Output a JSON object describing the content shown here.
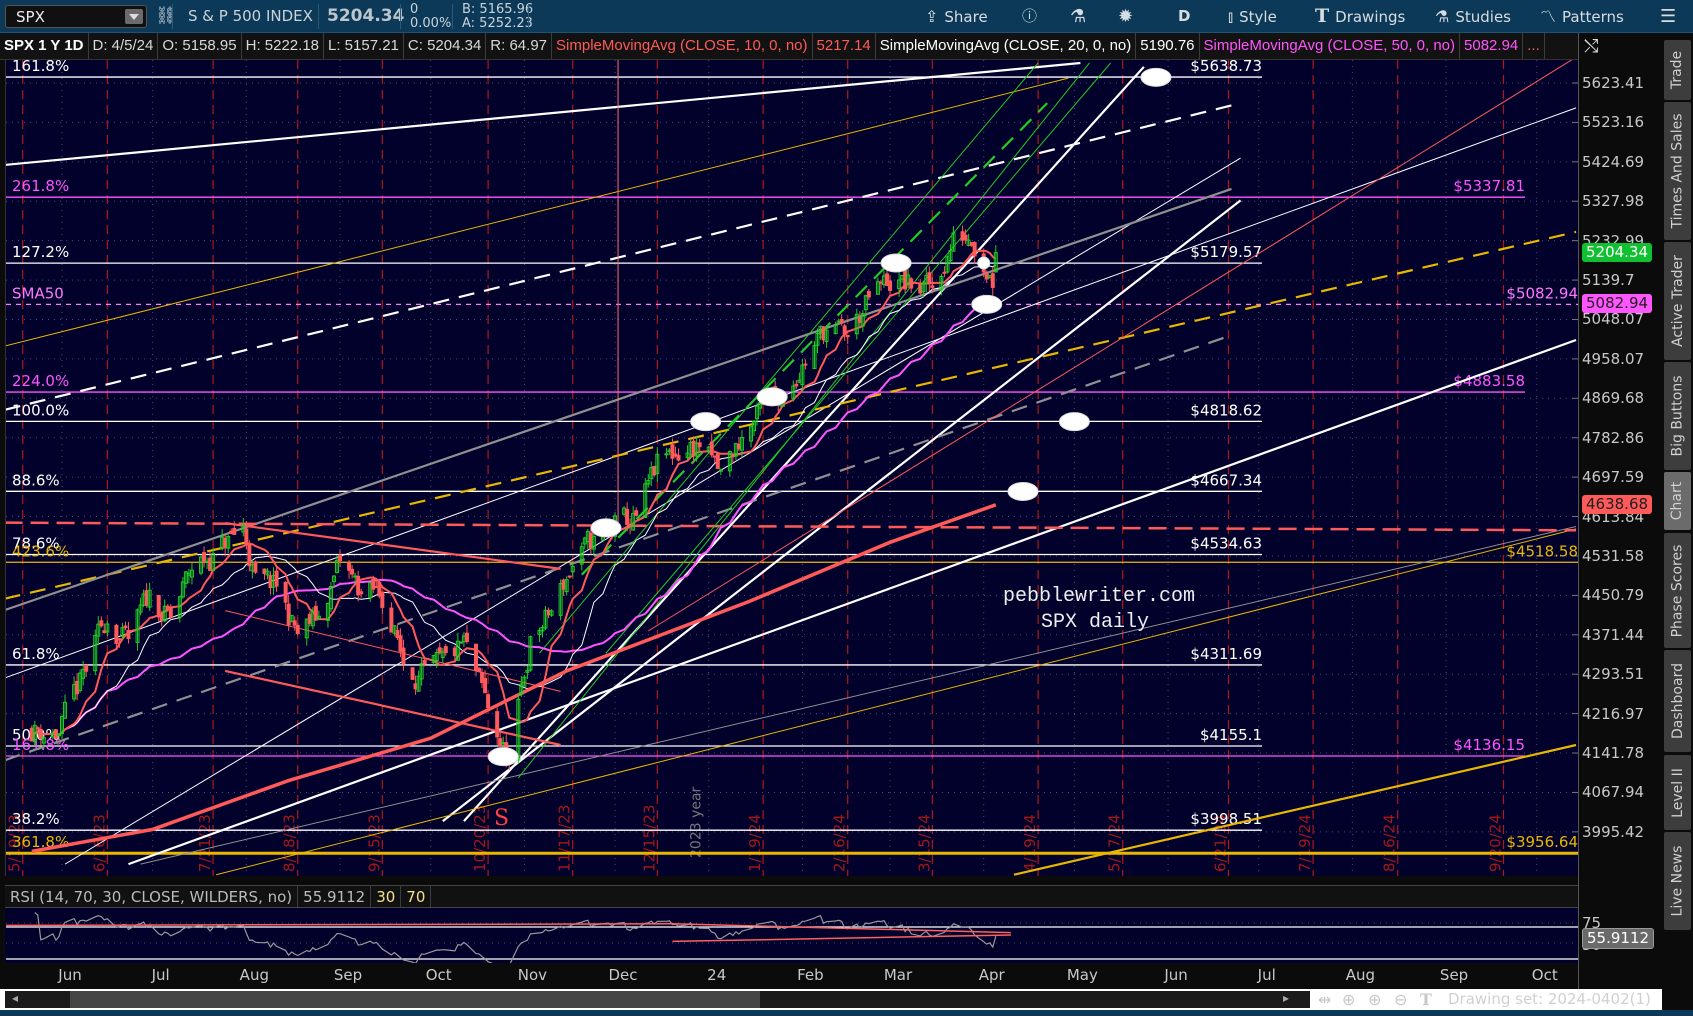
{
  "toolbar": {
    "symbol": "SPX",
    "description": "S & P 500 INDEX",
    "last": "5204.34",
    "change": "0",
    "change_pct": "0.00%",
    "bid": "B: 5165.96",
    "ask": "A: 5252.23",
    "share": "Share",
    "aggregation": "D",
    "style": "Style",
    "drawings": "Drawings",
    "studies": "Studies",
    "patterns": "Patterns"
  },
  "header": {
    "title": "SPX 1 Y 1D",
    "date": "D: 4/5/24",
    "open": "O: 5158.95",
    "high": "H: 5222.18",
    "low": "L: 5157.21",
    "close": "C: 5204.34",
    "range": "R: 64.97",
    "sma10_label": "SimpleMovingAvg (CLOSE, 10, 0, no)",
    "sma10_value": "5217.14",
    "sma20_label": "SimpleMovingAvg (CLOSE, 20, 0, no)",
    "sma20_value": "5190.76",
    "sma50_label": "SimpleMovingAvg (CLOSE, 50, 0, no)",
    "sma50_value": "5082.94",
    "more": "..."
  },
  "price_axis": {
    "ticks": [
      "5623.41",
      "5523.16",
      "5424.69",
      "5327.98",
      "5232.99",
      "5139.7",
      "5048.07",
      "4958.07",
      "4869.68",
      "4782.86",
      "4697.59",
      "4613.84",
      "4531.58",
      "4450.79",
      "4371.44",
      "4293.51",
      "4216.97",
      "4141.78",
      "4067.94",
      "3995.42"
    ],
    "badges": [
      {
        "value": "5204.34",
        "bg": "#10c030",
        "fg": "#ffffff"
      },
      {
        "value": "5082.94",
        "bg": "#ff55ff",
        "fg": "#202020"
      },
      {
        "value": "4638.68",
        "bg": "#ff5a5a",
        "fg": "#202020"
      }
    ]
  },
  "sidebar": [
    "Trade",
    "Times And Sales",
    "Active Trader",
    "Big Buttons",
    "Chart",
    "Phase Scores",
    "Dashboard",
    "Level II",
    "Live News"
  ],
  "sidebar_active": "Chart",
  "time_axis": [
    {
      "label": "Jun",
      "date": "2023-06-01"
    },
    {
      "label": "Jul",
      "date": "2023-07-01"
    },
    {
      "label": "Aug",
      "date": "2023-08-01"
    },
    {
      "label": "Sep",
      "date": "2023-09-01"
    },
    {
      "label": "Oct",
      "date": "2023-10-01"
    },
    {
      "label": "Nov",
      "date": "2023-11-01"
    },
    {
      "label": "Dec",
      "date": "2023-12-01"
    },
    {
      "label": "24",
      "date": "2024-01-01"
    },
    {
      "label": "Feb",
      "date": "2024-02-01"
    },
    {
      "label": "Mar",
      "date": "2024-03-01"
    },
    {
      "label": "Apr",
      "date": "2024-04-01"
    },
    {
      "label": "May",
      "date": "2024-05-01"
    },
    {
      "label": "Jun",
      "date": "2024-06-01"
    },
    {
      "label": "Jul",
      "date": "2024-07-01"
    },
    {
      "label": "Aug",
      "date": "2024-08-01"
    },
    {
      "label": "Sep",
      "date": "2024-09-01"
    },
    {
      "label": "Oct",
      "date": "2024-10-01"
    }
  ],
  "expiry_lines": [
    {
      "label": "5/19/23",
      "date": "2023-05-19"
    },
    {
      "label": "6/16/23",
      "date": "2023-06-16"
    },
    {
      "label": "7/21/23",
      "date": "2023-07-21"
    },
    {
      "label": "8/18/23",
      "date": "2023-08-18"
    },
    {
      "label": "9/15/23",
      "date": "2023-09-15"
    },
    {
      "label": "10/20/23",
      "date": "2023-10-20"
    },
    {
      "label": "11/17/23",
      "date": "2023-11-17"
    },
    {
      "label": "12/15/23",
      "date": "2023-12-15"
    },
    {
      "label": "1/19/24",
      "date": "2024-01-19"
    },
    {
      "label": "2/16/24",
      "date": "2024-02-16"
    },
    {
      "label": "3/15/24",
      "date": "2024-03-15"
    },
    {
      "label": "4/19/24",
      "date": "2024-04-19"
    },
    {
      "label": "5/17/24",
      "date": "2024-05-17"
    },
    {
      "label": "6/21/24",
      "date": "2024-06-21"
    },
    {
      "label": "7/19/24",
      "date": "2024-07-19"
    },
    {
      "label": "8/16/24",
      "date": "2024-08-16"
    },
    {
      "label": "9/20/24",
      "date": "2024-09-20"
    }
  ],
  "year_marker": {
    "label": "2023 year",
    "date": "2024-01-01"
  },
  "fib_levels": [
    {
      "pct": "161.8%",
      "price": 5638.73,
      "value": "$5638.73",
      "color": "#ffffff",
      "ext": "short"
    },
    {
      "pct": "261.8%",
      "price": 5337.81,
      "value": "$5337.81",
      "color": "#ff55ff",
      "ext": "long"
    },
    {
      "pct": "127.2%",
      "price": 5179.57,
      "value": "$5179.57",
      "color": "#ffffff",
      "ext": "short"
    },
    {
      "pct": "SMA50",
      "price": 5082.94,
      "value": "$5082.94",
      "color": "#ff77ff",
      "ext": "full",
      "dashed": true
    },
    {
      "pct": "224.0%",
      "price": 4883.58,
      "value": "$4883.58",
      "color": "#ff55ff",
      "ext": "long"
    },
    {
      "pct": "100.0%",
      "price": 4818.62,
      "value": "$4818.62",
      "color": "#ffffff",
      "ext": "short"
    },
    {
      "pct": "88.6%",
      "price": 4667.34,
      "value": "$4667.34",
      "color": "#ffffff",
      "ext": "short"
    },
    {
      "pct": "78.6%",
      "price": 4534.63,
      "value": "$4534.63",
      "color": "#ffffff",
      "ext": "short"
    },
    {
      "pct": "423.6%",
      "price": 4518.58,
      "value": "$4518.58",
      "color": "#e8b800",
      "ext": "full"
    },
    {
      "pct": "61.8%",
      "price": 4311.69,
      "value": "$4311.69",
      "color": "#ffffff",
      "ext": "short"
    },
    {
      "pct": "50.0%",
      "price": 4155.1,
      "value": "$4155.1",
      "color": "#ffffff",
      "ext": "short"
    },
    {
      "pct": "161.8%",
      "price": 4136.15,
      "value": "$4136.15",
      "color": "#ff55ff",
      "ext": "long"
    },
    {
      "pct": "38.2%",
      "price": 3998.51,
      "value": "$3998.51",
      "color": "#ffffff",
      "ext": "short"
    },
    {
      "pct": "361.8%",
      "price": 3956.64,
      "value": "$3956.64",
      "color": "#e8b800",
      "ext": "full",
      "thick": true
    }
  ],
  "chart_data": {
    "type": "candlestick",
    "title": "SPX 1 Y 1D",
    "scale": "log",
    "close_anchors": [
      [
        "2023-05-22",
        4190
      ],
      [
        "2023-05-31",
        4180
      ],
      [
        "2023-06-09",
        4298
      ],
      [
        "2023-06-16",
        4410
      ],
      [
        "2023-06-23",
        4348
      ],
      [
        "2023-06-30",
        4450
      ],
      [
        "2023-07-07",
        4399
      ],
      [
        "2023-07-14",
        4505
      ],
      [
        "2023-07-21",
        4536
      ],
      [
        "2023-07-31",
        4589
      ],
      [
        "2023-08-04",
        4478
      ],
      [
        "2023-08-11",
        4464
      ],
      [
        "2023-08-18",
        4370
      ],
      [
        "2023-08-25",
        4406
      ],
      [
        "2023-09-01",
        4515
      ],
      [
        "2023-09-08",
        4457
      ],
      [
        "2023-09-15",
        4450
      ],
      [
        "2023-09-22",
        4320
      ],
      [
        "2023-09-29",
        4288
      ],
      [
        "2023-10-06",
        4308
      ],
      [
        "2023-10-12",
        4350
      ],
      [
        "2023-10-20",
        4224
      ],
      [
        "2023-10-27",
        4117
      ],
      [
        "2023-11-03",
        4358
      ],
      [
        "2023-11-10",
        4415
      ],
      [
        "2023-11-17",
        4514
      ],
      [
        "2023-11-24",
        4559
      ],
      [
        "2023-12-01",
        4594
      ],
      [
        "2023-12-08",
        4604
      ],
      [
        "2023-12-15",
        4719
      ],
      [
        "2023-12-22",
        4754
      ],
      [
        "2023-12-29",
        4770
      ],
      [
        "2024-01-05",
        4697
      ],
      [
        "2024-01-12",
        4784
      ],
      [
        "2024-01-19",
        4840
      ],
      [
        "2024-01-26",
        4891
      ],
      [
        "2024-02-02",
        4959
      ],
      [
        "2024-02-09",
        5027
      ],
      [
        "2024-02-16",
        5006
      ],
      [
        "2024-02-23",
        5089
      ],
      [
        "2024-03-01",
        5137
      ],
      [
        "2024-03-08",
        5124
      ],
      [
        "2024-03-15",
        5117
      ],
      [
        "2024-03-22",
        5234
      ],
      [
        "2024-03-28",
        5254
      ],
      [
        "2024-04-04",
        5147
      ],
      [
        "2024-04-05",
        5204.34
      ]
    ],
    "last_bar": {
      "date": "2024-04-05",
      "open": 5158.95,
      "high": 5222.18,
      "low": 5157.21,
      "close": 5204.34
    },
    "sma200": [
      [
        "2023-05-22",
        3960
      ],
      [
        "2023-07-01",
        4000
      ],
      [
        "2023-08-15",
        4090
      ],
      [
        "2023-10-01",
        4170
      ],
      [
        "2023-11-15",
        4300
      ],
      [
        "2024-01-15",
        4440
      ],
      [
        "2024-03-01",
        4560
      ],
      [
        "2024-04-05",
        4638.68
      ]
    ],
    "colors": {
      "up": "#22cc22",
      "down": "#ff5a5a",
      "sma10": "#ff5a5a",
      "sma20": "#ffffff",
      "sma50": "#ff55ff",
      "sma200": "#ff5a5a"
    },
    "trendlines": [
      {
        "a": [
          "2023-05-13",
          5417
        ],
        "b": [
          "2024-05-03",
          5675
        ],
        "color": "#ffffff",
        "style": "thick"
      },
      {
        "a": [
          "2023-05-13",
          4844
        ],
        "b": [
          "2024-06-25",
          5572
        ],
        "color": "#ffffff",
        "style": "dash"
      },
      {
        "a": [
          "2023-10-05",
          4015
        ],
        "b": [
          "2024-06-25",
          5330
        ],
        "color": "#ffffff",
        "style": "thick"
      },
      {
        "a": [
          "2023-10-12",
          4015
        ],
        "b": [
          "2024-05-24",
          5665
        ],
        "color": "#ffffff",
        "style": "thick"
      },
      {
        "a": [
          "2023-06-02",
          3937
        ],
        "b": [
          "2024-06-25",
          5434
        ],
        "color": "#ffffff",
        "style": "thin"
      },
      {
        "a": [
          "2023-06-23",
          3937
        ],
        "b": [
          "2024-10-14",
          5001
        ],
        "color": "#ffffff",
        "style": "thick"
      },
      {
        "a": [
          "2023-05-13",
          4286
        ],
        "b": [
          "2024-10-14",
          5560
        ],
        "color": "#ffffff",
        "style": "thin"
      },
      {
        "a": [
          "2023-05-13",
          4444
        ],
        "b": [
          "2024-10-14",
          5254
        ],
        "color": "#e8b800",
        "style": "dash"
      },
      {
        "a": [
          "2023-05-13",
          4987
        ],
        "b": [
          "2024-04-29",
          5636
        ],
        "color": "#e8b800",
        "style": "thin"
      },
      {
        "a": [
          "2023-07-22",
          3918
        ],
        "b": [
          "2024-10-14",
          4588
        ],
        "color": "#e8b800",
        "style": "thin"
      },
      {
        "a": [
          "2024-04-11",
          3918
        ],
        "b": [
          "2024-10-14",
          4157
        ],
        "color": "#e8b800",
        "style": "thick"
      },
      {
        "a": [
          "2023-05-13",
          4421
        ],
        "b": [
          "2024-06-22",
          5358
        ],
        "color": "#909090",
        "style": "thick"
      },
      {
        "a": [
          "2023-05-13",
          4128
        ],
        "b": [
          "2024-06-22",
          5012
        ],
        "color": "#909090",
        "style": "dash"
      },
      {
        "a": [
          "2023-06-27",
          3937
        ],
        "b": [
          "2024-10-14",
          4593
        ],
        "color": "#909090",
        "style": "thin"
      },
      {
        "a": [
          "2023-12-12",
          4379
        ],
        "b": [
          "2024-10-14",
          5690
        ],
        "color": "#ff5a5a",
        "style": "thin"
      },
      {
        "a": [
          "2023-05-13",
          4601
        ],
        "b": [
          "2024-10-14",
          4585
        ],
        "color": "#ff5a5a",
        "style": "bigdash"
      },
      {
        "a": [
          "2023-10-30",
          4095
        ],
        "b": [
          "2024-05-06",
          5675
        ],
        "color": "#22cc22",
        "style": "thin"
      },
      {
        "a": [
          "2023-11-06",
          4335
        ],
        "b": [
          "2024-04-19",
          5675
        ],
        "color": "#22cc22",
        "style": "thin"
      },
      {
        "a": [
          "2023-11-20",
          4493
        ],
        "b": [
          "2024-04-22",
          5572
        ],
        "color": "#22cc22",
        "style": "dash"
      },
      {
        "a": [
          "2023-11-28",
          4335
        ],
        "b": [
          "2024-05-13",
          5675
        ],
        "color": "#22cc22",
        "style": "thin"
      },
      {
        "a": [
          "2023-07-25",
          4600
        ],
        "b": [
          "2023-11-13",
          4505
        ],
        "color": "#ff5a5a",
        "style": "thick"
      },
      {
        "a": [
          "2023-07-25",
          4420
        ],
        "b": [
          "2023-11-13",
          4260
        ],
        "color": "#ff5a5a",
        "style": "thin"
      },
      {
        "a": [
          "2023-07-25",
          4300
        ],
        "b": [
          "2023-11-13",
          4157
        ],
        "color": "#ff5a5a",
        "style": "thick"
      },
      {
        "a": [
          "2023-12-02",
          5720
        ],
        "b": [
          "2023-12-02",
          4590
        ],
        "color": "#ff7070",
        "style": "thin"
      }
    ],
    "markers": [
      [
        "2024-05-28",
        5638
      ],
      [
        "2024-03-03",
        5180
      ],
      [
        "2024-04-01",
        5180
      ],
      [
        "2024-04-02",
        5083
      ],
      [
        "2024-01-22",
        4873
      ],
      [
        "2023-12-31",
        4818
      ],
      [
        "2024-05-01",
        4818
      ],
      [
        "2024-04-14",
        4667
      ],
      [
        "2023-11-28",
        4590
      ],
      [
        "2023-10-25",
        4135
      ]
    ]
  },
  "annotations": {
    "site": "pebblewriter.com",
    "subtitle": "SPX daily",
    "wave_label": "S"
  },
  "rsi": {
    "label": "RSI (14, 70, 30, CLOSE, WILDERS, no)",
    "value": "55.9112",
    "oversold": "30",
    "overbought": "70",
    "axis_ticks": [
      "75",
      "50"
    ]
  },
  "footer": {
    "drawing_set": "Drawing set: 2024-0402(1)"
  }
}
